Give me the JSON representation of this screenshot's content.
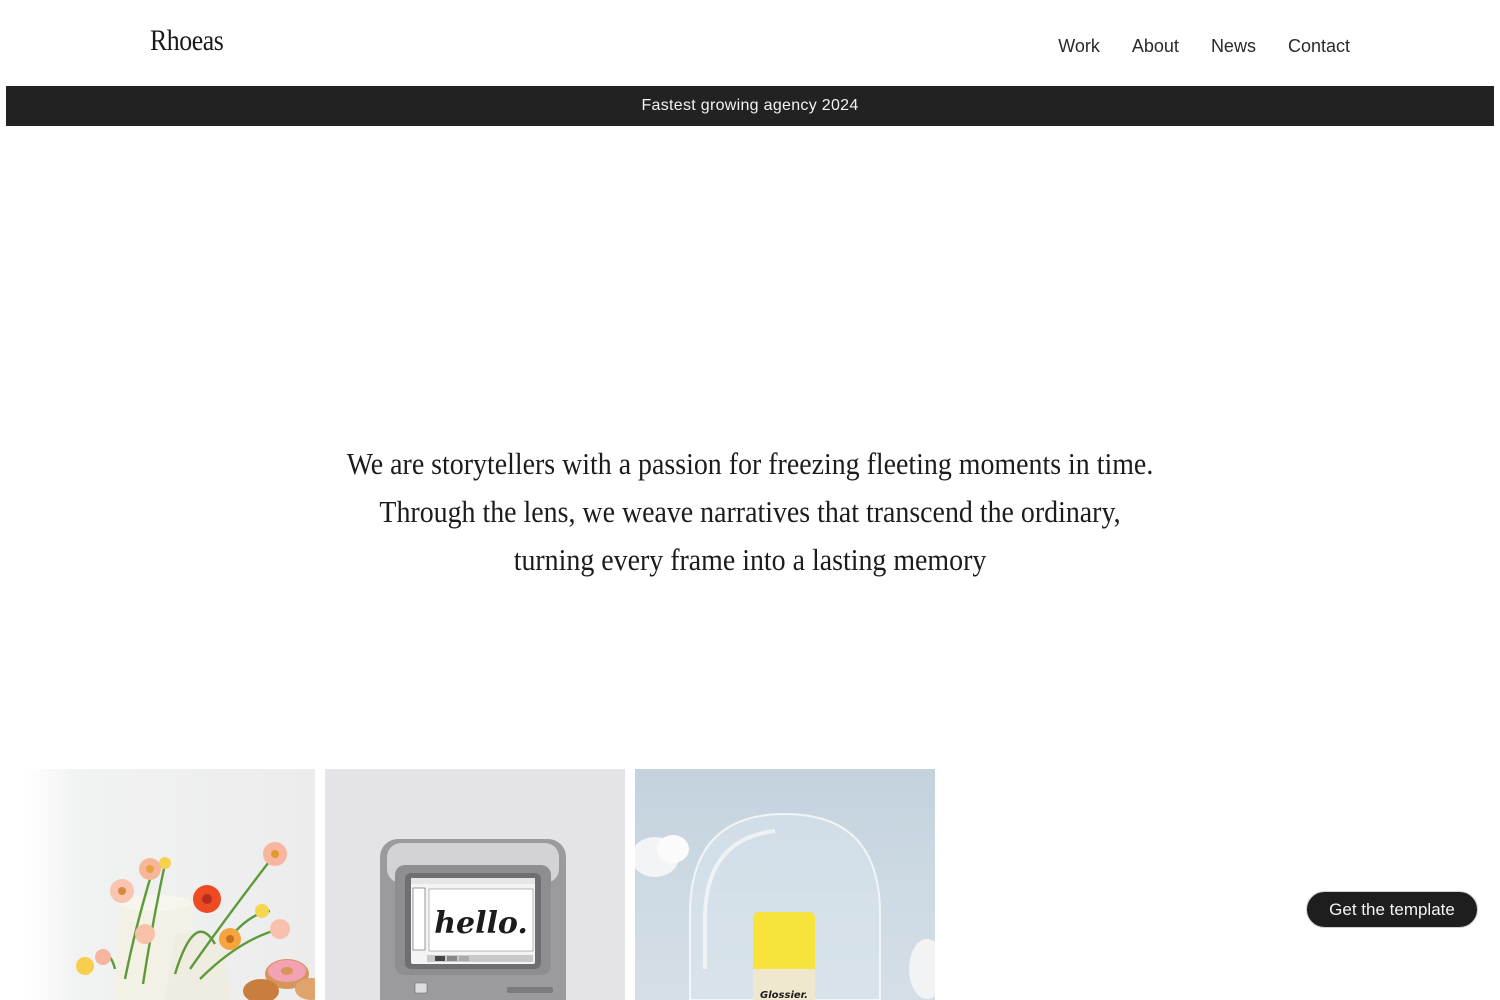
{
  "header": {
    "logo": "Rhoeas",
    "nav": [
      {
        "label": "Work"
      },
      {
        "label": "About"
      },
      {
        "label": "News"
      },
      {
        "label": "Contact"
      }
    ]
  },
  "announcement": {
    "text": "Fastest growing agency 2024"
  },
  "hero": {
    "lines": [
      "We are storytellers with a passion for freezing fleeting moments in time.",
      "Through the lens, we weave narratives that transcend the ordinary,",
      "turning every frame into a lasting memory"
    ]
  },
  "gallery": {
    "items": [
      {
        "subject": "flowers-and-donuts-photo"
      },
      {
        "subject": "retro-computer-photo",
        "screen_text": "hello."
      },
      {
        "subject": "glossier-product-photo",
        "brand_text": "Glossier."
      }
    ]
  },
  "cta": {
    "label": "Get the template"
  },
  "colors": {
    "announce_bg": "#222222",
    "cta_bg": "#1e1e1e",
    "text": "#1f1f1f"
  }
}
